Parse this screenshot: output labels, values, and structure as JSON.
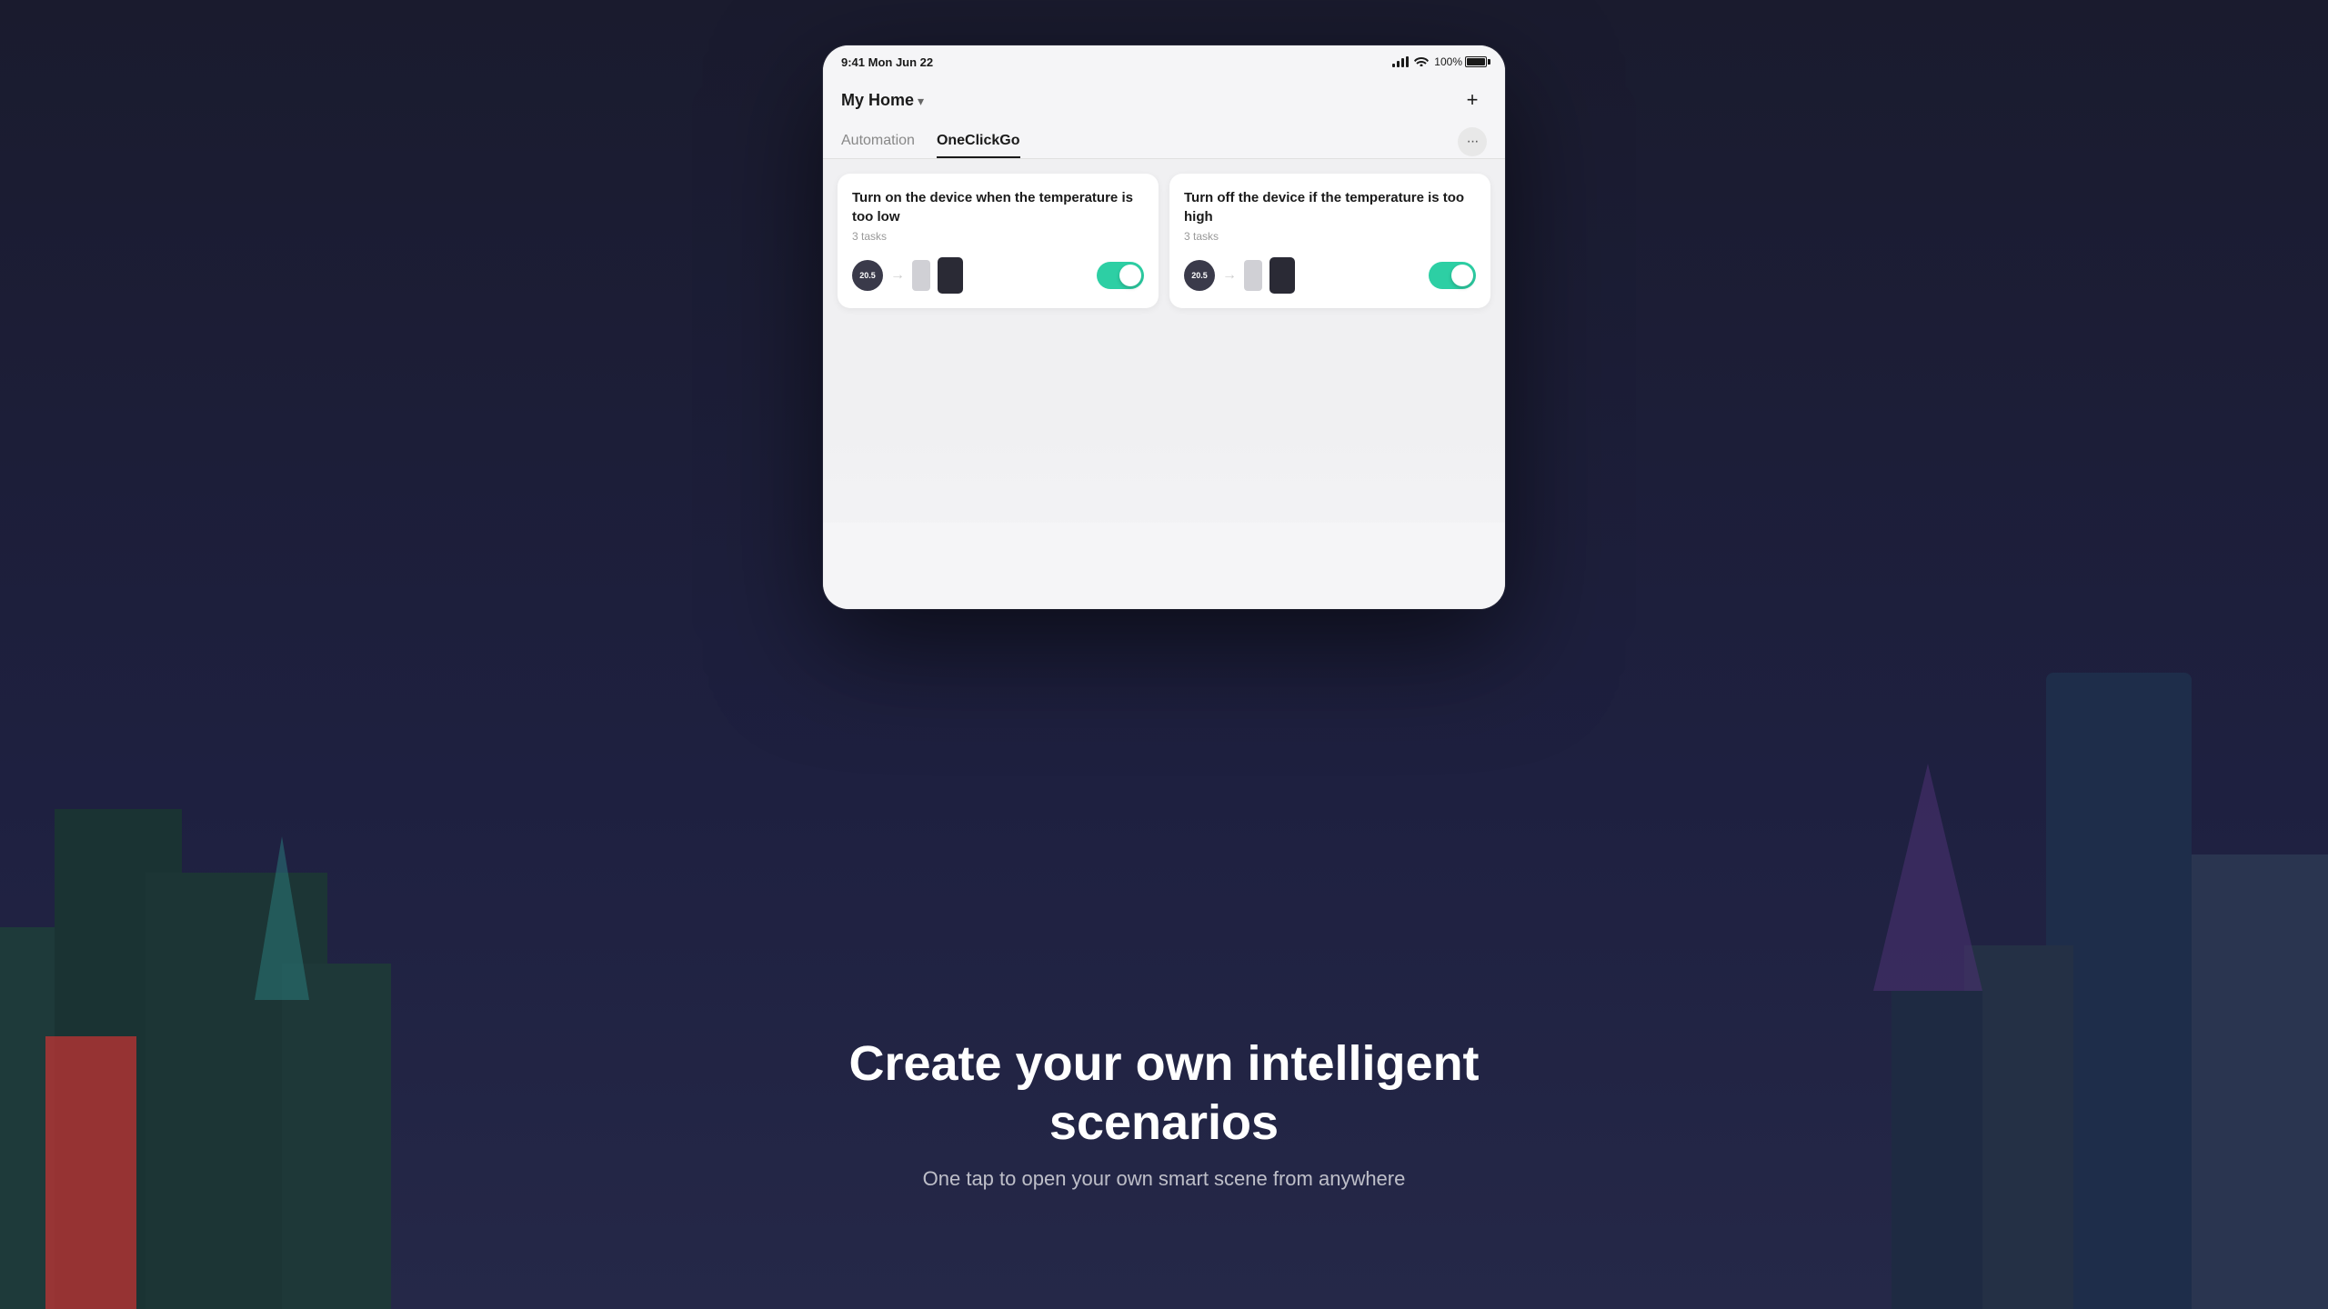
{
  "background": {
    "color": "#1a1b2e"
  },
  "status_bar": {
    "time": "9:41  Mon Jun 22",
    "battery_percent": "100%",
    "signal": "●●●●"
  },
  "header": {
    "home_label": "My Home",
    "chevron": "▾",
    "add_button": "+"
  },
  "tabs": [
    {
      "label": "Automation",
      "active": false
    },
    {
      "label": "OneClickGo",
      "active": true
    }
  ],
  "more_button": "···",
  "automation_cards": [
    {
      "title": "Turn on the device when the temperature is too low",
      "tasks": "3 tasks",
      "temp_label": "20.5",
      "toggle_on": true
    },
    {
      "title": "Turn off the device if the temperature is too high",
      "tasks": "3 tasks",
      "temp_label": "20.5",
      "toggle_on": true
    }
  ],
  "footer": {
    "headline": "Create your own intelligent scenarios",
    "subheadline": "One tap to open your own smart scene from anywhere"
  }
}
